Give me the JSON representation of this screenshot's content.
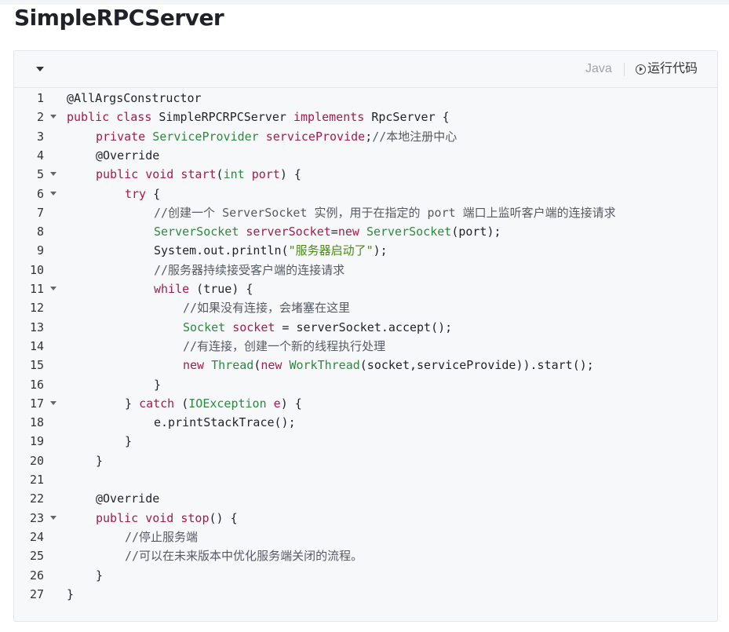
{
  "page": {
    "title": "SimpleRPCServer"
  },
  "toolbar": {
    "language": "Java",
    "run_label": "运行代码",
    "run_icon": "play-circle-icon",
    "collapse_icon": "caret-down-icon"
  },
  "code": {
    "lines": [
      {
        "n": "1",
        "indent": 0,
        "fold": false,
        "tokens": [
          [
            "@AllArgsConstructor",
            "p"
          ]
        ]
      },
      {
        "n": "2",
        "indent": 0,
        "fold": true,
        "tokens": [
          [
            "public",
            "kw"
          ],
          [
            " ",
            "p"
          ],
          [
            "class",
            "kw"
          ],
          [
            " SimpleRPCRPCServer ",
            "p"
          ],
          [
            "implements",
            "kw"
          ],
          [
            " RpcServer {",
            "p"
          ]
        ]
      },
      {
        "n": "3",
        "indent": 1,
        "fold": false,
        "tokens": [
          [
            "private",
            "kw"
          ],
          [
            " ",
            "p"
          ],
          [
            "ServiceProvider",
            "ty"
          ],
          [
            " ",
            "p"
          ],
          [
            "serviceProvide",
            "var"
          ],
          [
            ";",
            "p"
          ],
          [
            "//本地注册中心",
            "cm"
          ]
        ]
      },
      {
        "n": "4",
        "indent": 1,
        "fold": false,
        "tokens": [
          [
            "@Override",
            "p"
          ]
        ]
      },
      {
        "n": "5",
        "indent": 1,
        "fold": true,
        "tokens": [
          [
            "public",
            "kw"
          ],
          [
            " ",
            "p"
          ],
          [
            "void",
            "kw"
          ],
          [
            " ",
            "p"
          ],
          [
            "start",
            "var"
          ],
          [
            "(",
            "p"
          ],
          [
            "int",
            "ty"
          ],
          [
            " ",
            "p"
          ],
          [
            "port",
            "var"
          ],
          [
            ") {",
            "p"
          ]
        ]
      },
      {
        "n": "6",
        "indent": 2,
        "fold": true,
        "tokens": [
          [
            "try",
            "kw"
          ],
          [
            " {",
            "p"
          ]
        ]
      },
      {
        "n": "7",
        "indent": 3,
        "fold": false,
        "tokens": [
          [
            "//创建一个 ServerSocket 实例，用于在指定的 port 端口上监听客户端的连接请求",
            "cm"
          ]
        ]
      },
      {
        "n": "8",
        "indent": 3,
        "fold": false,
        "tokens": [
          [
            "ServerSocket",
            "ty"
          ],
          [
            " ",
            "p"
          ],
          [
            "serverSocket",
            "var"
          ],
          [
            "=",
            "p"
          ],
          [
            "new",
            "kw"
          ],
          [
            " ",
            "p"
          ],
          [
            "ServerSocket",
            "ty"
          ],
          [
            "(port);",
            "p"
          ]
        ]
      },
      {
        "n": "9",
        "indent": 3,
        "fold": false,
        "tokens": [
          [
            "System.out.println(",
            "p"
          ],
          [
            "\"服务器启动了\"",
            "st"
          ],
          [
            ");",
            "p"
          ]
        ]
      },
      {
        "n": "10",
        "indent": 3,
        "fold": false,
        "tokens": [
          [
            "//服务器持续接受客户端的连接请求",
            "cm"
          ]
        ]
      },
      {
        "n": "11",
        "indent": 3,
        "fold": true,
        "tokens": [
          [
            "while",
            "kw"
          ],
          [
            " (true) {",
            "p"
          ]
        ]
      },
      {
        "n": "12",
        "indent": 4,
        "fold": false,
        "tokens": [
          [
            "//如果没有连接，会堵塞在这里",
            "cm"
          ]
        ]
      },
      {
        "n": "13",
        "indent": 4,
        "fold": false,
        "tokens": [
          [
            "Socket",
            "ty"
          ],
          [
            " ",
            "p"
          ],
          [
            "socket",
            "var"
          ],
          [
            " = serverSocket.accept();",
            "p"
          ]
        ]
      },
      {
        "n": "14",
        "indent": 4,
        "fold": false,
        "tokens": [
          [
            "//有连接，创建一个新的线程执行处理",
            "cm"
          ]
        ]
      },
      {
        "n": "15",
        "indent": 4,
        "fold": false,
        "tokens": [
          [
            "new",
            "kw"
          ],
          [
            " ",
            "p"
          ],
          [
            "Thread",
            "ty"
          ],
          [
            "(",
            "p"
          ],
          [
            "new",
            "kw"
          ],
          [
            " ",
            "p"
          ],
          [
            "WorkThread",
            "ty"
          ],
          [
            "(socket,serviceProvide)).start();",
            "p"
          ]
        ]
      },
      {
        "n": "16",
        "indent": 3,
        "fold": false,
        "tokens": [
          [
            "}",
            "p"
          ]
        ]
      },
      {
        "n": "17",
        "indent": 2,
        "fold": true,
        "tokens": [
          [
            "} ",
            "p"
          ],
          [
            "catch",
            "kw"
          ],
          [
            " (",
            "p"
          ],
          [
            "IOException",
            "ty"
          ],
          [
            " ",
            "p"
          ],
          [
            "e",
            "var"
          ],
          [
            ") {",
            "p"
          ]
        ]
      },
      {
        "n": "18",
        "indent": 3,
        "fold": false,
        "tokens": [
          [
            "e.printStackTrace();",
            "p"
          ]
        ]
      },
      {
        "n": "19",
        "indent": 2,
        "fold": false,
        "tokens": [
          [
            "}",
            "p"
          ]
        ]
      },
      {
        "n": "20",
        "indent": 1,
        "fold": false,
        "tokens": [
          [
            "}",
            "p"
          ]
        ]
      },
      {
        "n": "21",
        "indent": 0,
        "fold": false,
        "tokens": []
      },
      {
        "n": "22",
        "indent": 1,
        "fold": false,
        "tokens": [
          [
            "@Override",
            "p"
          ]
        ]
      },
      {
        "n": "23",
        "indent": 1,
        "fold": true,
        "tokens": [
          [
            "public",
            "kw"
          ],
          [
            " ",
            "p"
          ],
          [
            "void",
            "kw"
          ],
          [
            " ",
            "p"
          ],
          [
            "stop",
            "var"
          ],
          [
            "() {",
            "p"
          ]
        ]
      },
      {
        "n": "24",
        "indent": 2,
        "fold": false,
        "tokens": [
          [
            "//停止服务端",
            "cm"
          ]
        ]
      },
      {
        "n": "25",
        "indent": 2,
        "fold": false,
        "tokens": [
          [
            "//可以在未来版本中优化服务端关闭的流程。",
            "cm"
          ]
        ]
      },
      {
        "n": "26",
        "indent": 1,
        "fold": false,
        "tokens": [
          [
            "}",
            "p"
          ]
        ]
      },
      {
        "n": "27",
        "indent": 0,
        "fold": false,
        "tokens": [
          [
            "}",
            "p"
          ]
        ]
      }
    ]
  }
}
